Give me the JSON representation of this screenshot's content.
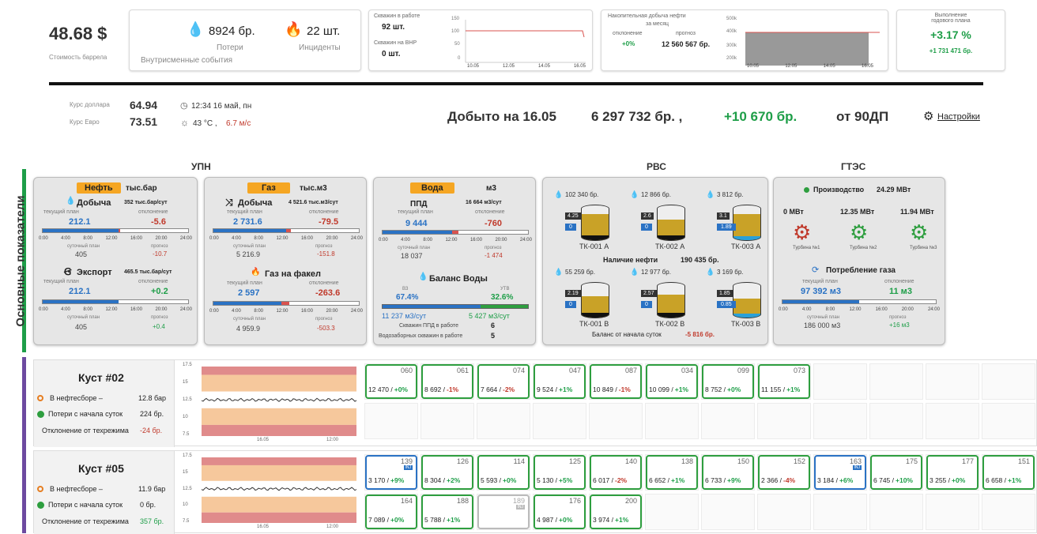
{
  "header": {
    "barrel": {
      "price": "48.68 $",
      "label": "Стоимость баррела"
    },
    "losses": {
      "value": "8924 бр.",
      "label": "Потери"
    },
    "incidents": {
      "value": "22 шт.",
      "label": "Инциденты"
    },
    "events_label": "Внутрисменные события",
    "wells": {
      "working_label": "Скважин в работе",
      "working": "92 шт.",
      "vnr_label": "Скважин на ВНР",
      "vnr": "0 шт.",
      "y_ticks": [
        "150",
        "100",
        "50",
        "0"
      ],
      "x_ticks": [
        "10.05",
        "12.05",
        "14.05",
        "16.05"
      ]
    },
    "oil_accum": {
      "title1": "Накопительная добыча нефти",
      "title2": "за месяц",
      "dev_label": "отклонение",
      "dev": "+0%",
      "fc_label": "прогноз",
      "fc": "12 560 567 бр.",
      "y_ticks": [
        "500k",
        "400k",
        "300k",
        "200k"
      ],
      "x_ticks": [
        "10.05",
        "12.05",
        "14.05",
        "16.05"
      ]
    },
    "annual": {
      "title1": "Выполнение",
      "title2": "годового плана",
      "pct": "+3.17 %",
      "abs": "+1 731 471 бр."
    }
  },
  "info": {
    "usd_label": "Курс доллара",
    "usd": "64.94",
    "eur_label": "Курс Евро",
    "eur": "73.51",
    "time": "12:34 16 май, пн",
    "temp": "43 °C ,",
    "wind": "6.7 м/с",
    "mined_prefix": "Добыто на 16.05",
    "mined_value": "6 297 732 бр. ,",
    "mined_delta": "+10 670 бр.",
    "mined_from": "от 90ДП",
    "settings": "Настройки"
  },
  "side_label": "Основные показатели",
  "sections": {
    "upn": "УПН",
    "rvs": "РВС",
    "gtes": "ГТЭС"
  },
  "scale": [
    "0:00",
    "4:00",
    "8:00",
    "12:00",
    "16:00",
    "20:00",
    "24:00"
  ],
  "oil": {
    "tag": "Нефть",
    "unit": "тыс.бар",
    "prod": {
      "title": "Добыча",
      "rate": "352 тыс.бар/сут",
      "plan_label": "текущий план",
      "plan": "212.1",
      "dev_label": "отклонение",
      "dev": "-5.6",
      "day_label": "суточный план",
      "day": "405",
      "fc_label": "прогноз",
      "fc": "-10.7",
      "fill": 0.52,
      "red_from": 0.52,
      "red_to": 0.53
    },
    "exp": {
      "title": "Экспорт",
      "rate": "465.5 тыс.бар/сут",
      "plan_label": "текущий план",
      "plan": "212.1",
      "dev_label": "отклонение",
      "dev": "+0.2",
      "day_label": "суточный план",
      "day": "405",
      "fc_label": "прогноз",
      "fc": "+0.4",
      "fill": 0.52
    }
  },
  "gas": {
    "tag": "Газ",
    "unit": "тыс.м3",
    "prod": {
      "title": "Добыча",
      "rate": "4 521.6 тыс.м3/сут",
      "plan_label": "текущий план",
      "plan": "2 731.6",
      "dev_label": "отклонение",
      "dev": "-79.5",
      "day_label": "суточный план",
      "day": "5 216.9",
      "fc_label": "прогноз",
      "fc": "-151.8",
      "fill": 0.5,
      "red_from": 0.5,
      "red_to": 0.53
    },
    "flare": {
      "title": "Газ на факел",
      "plan_label": "текущий план",
      "plan": "2 597",
      "dev_label": "отклонение",
      "dev": "-263.6",
      "day_label": "суточный план",
      "day": "4 959.9",
      "fc_label": "прогноз",
      "fc": "-503.3",
      "fill": 0.47,
      "red_from": 0.47,
      "red_to": 0.52
    }
  },
  "water": {
    "tag": "Вода",
    "unit": "м3",
    "ppd": {
      "title": "ППД",
      "rate": "16 664 м3/сут",
      "plan_label": "текущий план",
      "plan": "9 444",
      "dev_label": "отклонение",
      "dev": "-760",
      "day_label": "суточный план",
      "day": "18 037",
      "fc_label": "прогноз",
      "fc": "-1 474",
      "fill": 0.48,
      "red_from": 0.48,
      "red_to": 0.52
    },
    "balance": {
      "title": "Баланс Воды",
      "vz_label": "ВЗ",
      "vz": "67.4%",
      "utv_label": "УТВ",
      "utv": "32.6%",
      "vz_val": "11 237 м3/сут",
      "utv_val": "5 427 м3/сут",
      "ppd_wells_label": "Скважин ППД в работе",
      "ppd_wells": "6",
      "water_wells_label": "Водозаборных скважин в работе",
      "water_wells": "5",
      "split": 0.674
    }
  },
  "rvs": {
    "row1": [
      {
        "amount": "102 340 бр.",
        "level": "4.25",
        "sub": "0",
        "name": "ТК-001 А",
        "fill": 0.75,
        "blue": 0
      },
      {
        "amount": "12 866 бр.",
        "level": "2.6",
        "sub": "0",
        "name": "ТК-002 А",
        "fill": 0.6,
        "blue": 0
      },
      {
        "amount": "3 812 бр.",
        "level": "3.1",
        "sub": "1.89",
        "name": "ТК-003 А",
        "fill": 0.75,
        "blue": 0.12
      }
    ],
    "oil_label": "Наличие нефти",
    "oil_value": "190 435 бр.",
    "row2": [
      {
        "amount": "55 259 бр.",
        "level": "2.19",
        "sub": "0",
        "name": "ТК-001 В",
        "fill": 0.62,
        "blue": 0
      },
      {
        "amount": "12 977 бр.",
        "level": "2.57",
        "sub": "0",
        "name": "ТК-002 В",
        "fill": 0.66,
        "blue": 0
      },
      {
        "amount": "3 169 бр.",
        "level": "1.85",
        "sub": "0.85",
        "name": "ТК-003 В",
        "fill": 0.55,
        "blue": 0.12
      }
    ],
    "balance_label": "Баланс от начала суток",
    "balance_value": "-5 816 бр."
  },
  "gtes": {
    "prod_label": "Производство",
    "prod": "24.29 МВт",
    "turbines": [
      {
        "mw": "0 МВт",
        "name": "Турбина №1",
        "color": "#c0392b"
      },
      {
        "mw": "12.35 МВт",
        "name": "Турбина №2",
        "color": "#2e9e3f"
      },
      {
        "mw": "11.94 МВт",
        "name": "Турбина №3",
        "color": "#2e9e3f"
      }
    ],
    "cons": {
      "title": "Потребление газа",
      "plan_label": "текущий план",
      "plan": "97 392 м3",
      "dev_label": "отклонение",
      "dev": "11 м3",
      "day_label": "суточный план",
      "day": "186 000 м3",
      "fc_label": "прогноз",
      "fc": "+16 м3",
      "fill": 0.5
    }
  },
  "clusters": [
    {
      "title": "Куст #02",
      "row1_label": "В нефтесборе –",
      "row1": "12.8 бар",
      "row2_label": "Потери с начала суток",
      "row2": "224 бр.",
      "row3_label": "Отклонение от техрежима",
      "row3": "-24 бр.",
      "row3_color": "#c0392b",
      "y": [
        "17.5",
        "15",
        "12.5",
        "10",
        "7.5"
      ],
      "x": [
        "16.05",
        "12:00"
      ],
      "wells": [
        {
          "n": "060",
          "v": "12 470 /",
          "d": "+0%",
          "dc": "green"
        },
        {
          "n": "061",
          "v": "8 692 /",
          "d": "-1%",
          "dc": "red"
        },
        {
          "n": "074",
          "v": "7 664 /",
          "d": "-2%",
          "dc": "red"
        },
        {
          "n": "047",
          "v": "9 524 /",
          "d": "+1%",
          "dc": "green"
        },
        {
          "n": "087",
          "v": "10 849 /",
          "d": "-1%",
          "dc": "red"
        },
        {
          "n": "034",
          "v": "10 099 /",
          "d": "+1%",
          "dc": "green"
        },
        {
          "n": "099",
          "v": "8 752 /",
          "d": "+0%",
          "dc": "green"
        },
        {
          "n": "073",
          "v": "11 155 /",
          "d": "+1%",
          "dc": "green"
        }
      ]
    },
    {
      "title": "Куст #05",
      "row1_label": "В нефтесборе –",
      "row1": "11.9 бар",
      "row2_label": "Потери с начала суток",
      "row2": "0 бр.",
      "row3_label": "Отклонение от техрежима",
      "row3": "357 бр.",
      "row3_color": "#1e9e48",
      "y": [
        "17.5",
        "15",
        "12.5",
        "10",
        "7.5"
      ],
      "x": [
        "16.05",
        "12:00"
      ],
      "wells": [
        {
          "n": "139",
          "v": "3 170 /",
          "d": "+9%",
          "dc": "green",
          "t": "blue"
        },
        {
          "n": "126",
          "v": "8 304 /",
          "d": "+2%",
          "dc": "green"
        },
        {
          "n": "114",
          "v": "5 593 /",
          "d": "+0%",
          "dc": "green"
        },
        {
          "n": "125",
          "v": "5 130 /",
          "d": "+5%",
          "dc": "green"
        },
        {
          "n": "140",
          "v": "6 017 /",
          "d": "-2%",
          "dc": "red"
        },
        {
          "n": "138",
          "v": "6 652 /",
          "d": "+1%",
          "dc": "green"
        },
        {
          "n": "150",
          "v": "6 733 /",
          "d": "+9%",
          "dc": "green"
        },
        {
          "n": "152",
          "v": "2 366 /",
          "d": "-4%",
          "dc": "red"
        },
        {
          "n": "163",
          "v": "3 184 /",
          "d": "+6%",
          "dc": "green",
          "t": "blue"
        },
        {
          "n": "175",
          "v": "6 745 /",
          "d": "+10%",
          "dc": "green"
        },
        {
          "n": "177",
          "v": "3 255 /",
          "d": "+0%",
          "dc": "green"
        },
        {
          "n": "151",
          "v": "6 658 /",
          "d": "+1%",
          "dc": "green"
        },
        {
          "n": "164",
          "v": "7 089 /",
          "d": "+0%",
          "dc": "green"
        },
        {
          "n": "188",
          "v": "5 788 /",
          "d": "+1%",
          "dc": "green"
        },
        {
          "n": "189",
          "v": "",
          "d": "",
          "dc": "green",
          "t": "grey"
        },
        {
          "n": "176",
          "v": "4 987 /",
          "d": "+0%",
          "dc": "green"
        },
        {
          "n": "200",
          "v": "3 974 /",
          "d": "+1%",
          "dc": "green"
        }
      ]
    }
  ],
  "inj_label": "INJ"
}
